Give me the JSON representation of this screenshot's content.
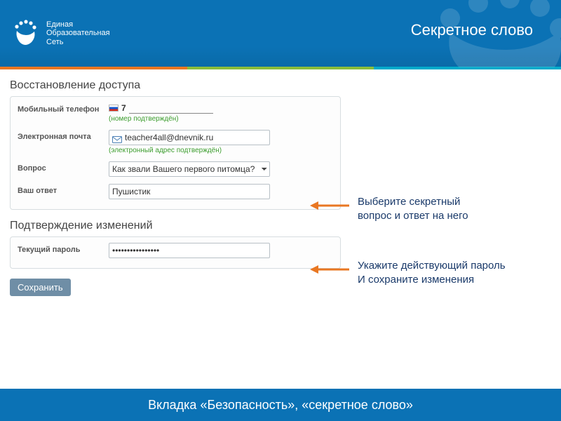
{
  "brand": {
    "line1": "Единая",
    "line2": "Образовательная",
    "line3": "Сеть"
  },
  "page_title": "Секретное слово",
  "sections": {
    "recovery": {
      "title": "Восстановление доступа",
      "phone": {
        "label": "Мобильный телефон",
        "code": "7",
        "value": "",
        "hint": "(номер подтверждён)"
      },
      "email": {
        "label": "Электронная почта",
        "value": "teacher4all@dnevnik.ru",
        "hint": "(электронный адрес подтверждён)"
      },
      "question": {
        "label": "Вопрос",
        "value": "Как звали Вашего первого питомца?"
      },
      "answer": {
        "label": "Ваш ответ",
        "value": "Пушистик"
      }
    },
    "confirm": {
      "title": "Подтверждение изменений",
      "password": {
        "label": "Текущий пароль",
        "value": "••••••••••••••••"
      }
    }
  },
  "callouts": {
    "c1_l1": "Выберите секретный",
    "c1_l2": "вопрос и ответ на него",
    "c2_l1": "Укажите действующий пароль",
    "c2_l2": "И сохраните изменения"
  },
  "buttons": {
    "save": "Сохранить"
  },
  "footer": "Вкладка «Безопасность», «секретное слово»"
}
